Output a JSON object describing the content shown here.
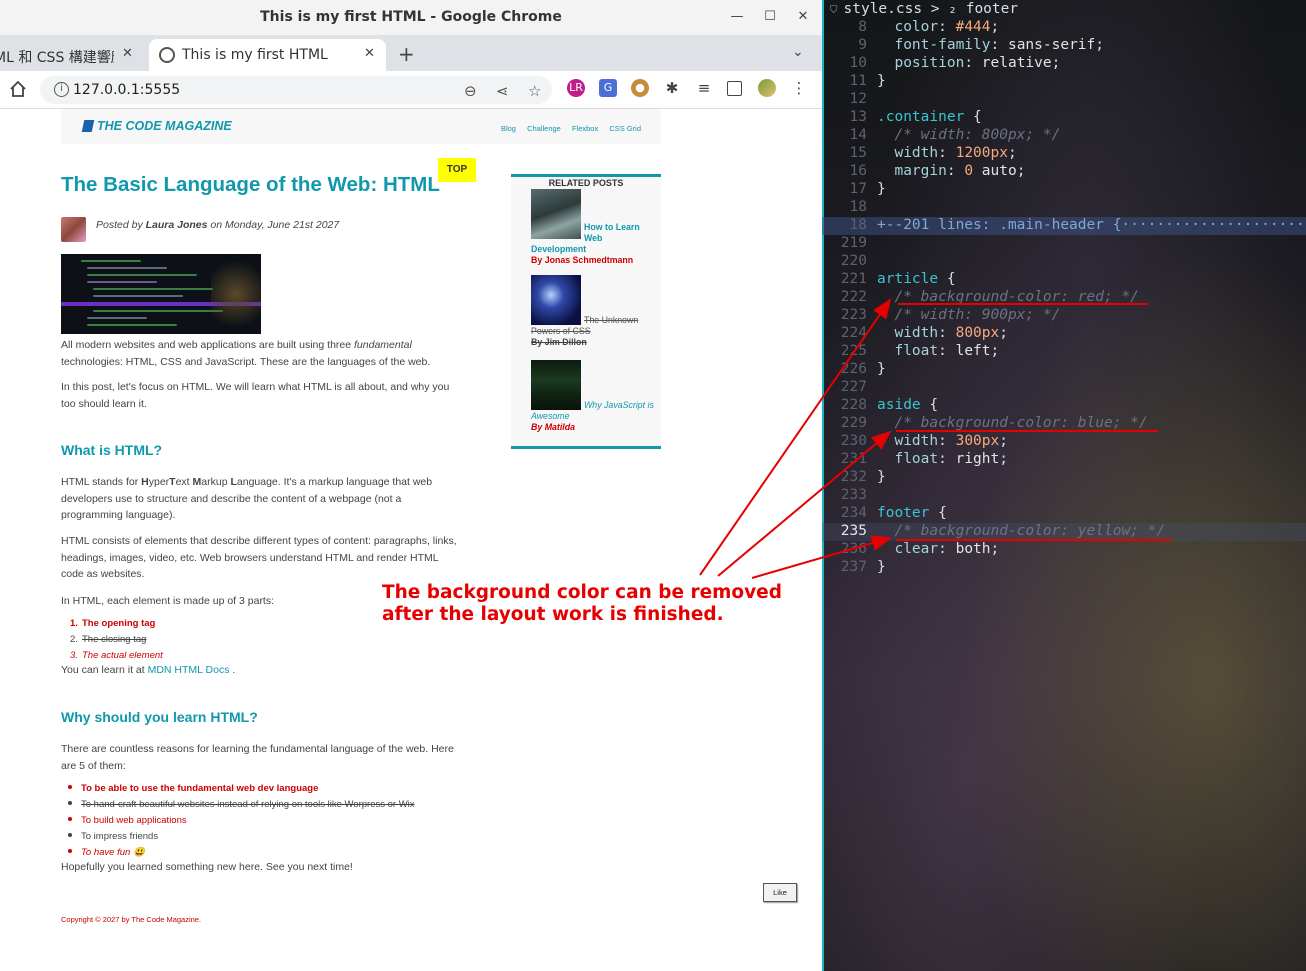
{
  "window": {
    "title": "This is my first HTML - Google Chrome",
    "tabs": [
      {
        "label": "ML 和 CSS 構建響應"
      },
      {
        "label": "This is my first HTML"
      }
    ],
    "url": "127.0.0.1:5555"
  },
  "site": {
    "logo": "THE CODE MAGAZINE",
    "nav": [
      "Blog",
      "Challenge",
      "Flexbox",
      "CSS Grid"
    ]
  },
  "article": {
    "title": "The Basic Language of the Web: HTML",
    "top_badge": "TOP",
    "posted_by": "Posted by",
    "author": "Laura Jones",
    "date": "on Monday, June 21st 2027",
    "intro1_a": "All modern websites and web applications are built using three",
    "intro1_em": "fundamental",
    "intro1_b": "technologies: HTML, CSS and JavaScript. These are the languages of the web.",
    "intro2": "In this post, let's focus on HTML. We will learn what HTML is all about, and why you too should learn it.",
    "h2_what": "What is HTML?",
    "what1_pre": "HTML stands for ",
    "what1_h": "H",
    "what1_yper": "yper",
    "what1_t": "T",
    "what1_ext": "ext ",
    "what1_m": "M",
    "what1_arkup": "arkup ",
    "what1_l": "L",
    "what1_post": "anguage. It's a markup language that web developers use to structure and describe the content of a webpage (not a programming language).",
    "what2": "HTML consists of elements that describe different types of content: paragraphs, links, headings, images, video, etc. Web browsers understand HTML and render HTML code as websites.",
    "what3": "In HTML, each element is made up of 3 parts:",
    "parts": [
      "The opening tag",
      "The closing tag",
      "The actual element"
    ],
    "mdn_pre": "You can learn it at",
    "mdn_link": "MDN HTML Docs",
    "mdn_post": ".",
    "h2_why": "Why should you learn HTML?",
    "why1": "There are countless reasons for learning the fundamental language of the web. Here are 5 of them:",
    "reasons": [
      "To be able to use the fundamental web dev language",
      "To hand-craft beautiful websites instead of relying on tools like Worpress or Wix",
      "To build web applications",
      "To impress friends",
      "To have fun 😃"
    ],
    "closing": "Hopefully you learned something new here. See you next time!",
    "like": "Like",
    "copyright": "Copyright © 2027 by The Code Magazine."
  },
  "aside": {
    "title": "RELATED POSTS",
    "posts": [
      {
        "title": "How to Learn Web Development",
        "author": "By Jonas Schmedtmann"
      },
      {
        "title": "The Unknown Powers of CSS",
        "author": "By Jim Dillon"
      },
      {
        "title": "Why JavaScript is Awesome",
        "author": "By Matilda"
      }
    ]
  },
  "annotation": {
    "line1": "The background color can be removed",
    "line2": "after the layout work is finished."
  },
  "editor": {
    "breadcrumb": "style.css > ₂ footer",
    "lines": [
      {
        "n": "8",
        "code": "  color: #444;"
      },
      {
        "n": "9",
        "code": "  font-family: sans-serif;"
      },
      {
        "n": "10",
        "code": "  position: relative;"
      },
      {
        "n": "11",
        "code": "}"
      },
      {
        "n": "12",
        "code": ""
      },
      {
        "n": "13",
        "code": ".container {"
      },
      {
        "n": "14",
        "code": "  /* width: 800px; */"
      },
      {
        "n": "15",
        "code": "  width: 1200px;"
      },
      {
        "n": "16",
        "code": "  margin: 0 auto;"
      },
      {
        "n": "17",
        "code": "}"
      },
      {
        "n": "18",
        "code": ""
      },
      {
        "n": "18",
        "code": "+--201 lines: .main-header {······················"
      },
      {
        "n": "219",
        "code": ""
      },
      {
        "n": "220",
        "code": ""
      },
      {
        "n": "221",
        "code": "article {"
      },
      {
        "n": "222",
        "code": "  /* background-color: red; */"
      },
      {
        "n": "223",
        "code": "  /* width: 900px; */"
      },
      {
        "n": "224",
        "code": "  width: 800px;"
      },
      {
        "n": "225",
        "code": "  float: left;"
      },
      {
        "n": "226",
        "code": "}"
      },
      {
        "n": "227",
        "code": ""
      },
      {
        "n": "228",
        "code": "aside {"
      },
      {
        "n": "229",
        "code": "  /* background-color: blue; */"
      },
      {
        "n": "230",
        "code": "  width: 300px;"
      },
      {
        "n": "231",
        "code": "  float: right;"
      },
      {
        "n": "232",
        "code": "}"
      },
      {
        "n": "233",
        "code": ""
      },
      {
        "n": "234",
        "code": "footer {"
      },
      {
        "n": "235",
        "code": "  /* background-color: yellow; */"
      },
      {
        "n": "236",
        "code": "  clear: both;"
      },
      {
        "n": "237",
        "code": "}"
      }
    ]
  },
  "colors": {
    "accent": "#1098ad",
    "annotation_red": "#e60000",
    "badge_yellow": "#ffff00"
  }
}
